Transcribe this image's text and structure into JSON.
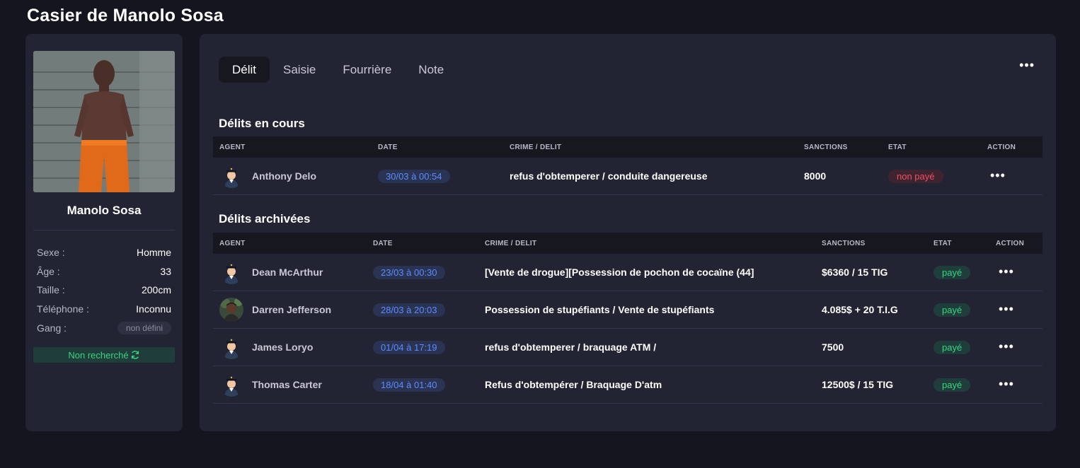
{
  "page_title": "Casier de Manolo Sosa",
  "profile": {
    "name": "Manolo Sosa",
    "rows": [
      {
        "label": "Sexe :",
        "value": "Homme"
      },
      {
        "label": "Âge :",
        "value": "33"
      },
      {
        "label": "Taille :",
        "value": "200cm"
      },
      {
        "label": "Téléphone :",
        "value": "Inconnu"
      },
      {
        "label": "Gang :",
        "value": "non défini"
      }
    ],
    "wanted_status": "Non recherché",
    "wanted_icon": "refresh-icon"
  },
  "tabs": [
    "Délit",
    "Saisie",
    "Fourrière",
    "Note"
  ],
  "active_tab": "Délit",
  "current": {
    "title": "Délits en cours",
    "headers": [
      "AGENT",
      "DATE",
      "CRIME / DELIT",
      "SANCTIONS",
      "ETAT",
      "ACTION"
    ],
    "rows": [
      {
        "agent": "Anthony Delo",
        "avatar": "police-avatar",
        "date": "30/03 à 00:54",
        "crime": "refus d'obtemperer / conduite dangereuse",
        "sanction": "8000",
        "state": "non payé",
        "state_type": "unpaid"
      }
    ]
  },
  "archived": {
    "title": "Délits archivées",
    "headers": [
      "AGENT",
      "DATE",
      "CRIME / DELIT",
      "SANCTIONS",
      "ETAT",
      "ACTION"
    ],
    "rows": [
      {
        "agent": "Dean McArthur",
        "avatar": "police-avatar",
        "date": "23/03 à 00:30",
        "crime": "[Vente de drogue][Possession de pochon de cocaïne (44]",
        "sanction": "$6360 / 15 TIG",
        "state": "payé",
        "state_type": "paid"
      },
      {
        "agent": "Darren Jefferson",
        "avatar": "photo-avatar",
        "date": "28/03 à 20:03",
        "crime": "Possession de stupéfiants / Vente de stupéfiants",
        "sanction": "4.085$ + 20 T.I.G",
        "state": "payé",
        "state_type": "paid"
      },
      {
        "agent": "James Loryo",
        "avatar": "police-avatar",
        "date": "01/04 à 17:19",
        "crime": "refus d'obtemperer / braquage ATM /",
        "sanction": "7500",
        "state": "payé",
        "state_type": "paid"
      },
      {
        "agent": "Thomas Carter",
        "avatar": "police-avatar",
        "date": "18/04 à 01:40",
        "crime": "Refus d'obtempérer / Braquage D'atm",
        "sanction": "12500$ / 15 TIG",
        "state": "payé",
        "state_type": "paid"
      }
    ]
  },
  "colors": {
    "background": "#15151f",
    "panel": "#232433",
    "date_badge_text": "#5b8cff",
    "paid": "#38d67d",
    "unpaid": "#ef4f68"
  }
}
